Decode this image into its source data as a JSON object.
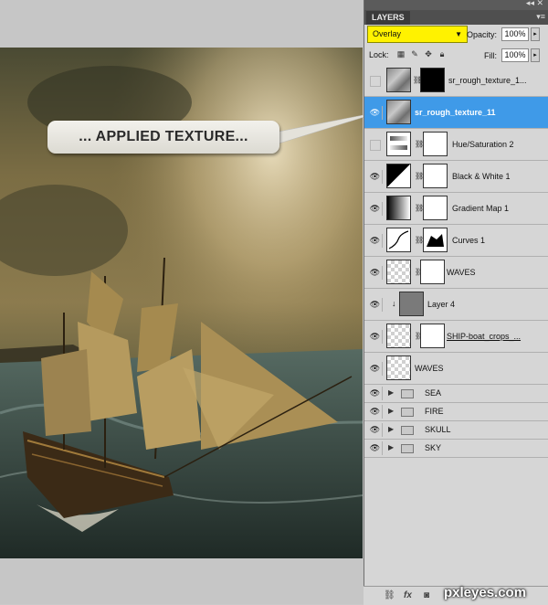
{
  "artwork": {
    "alt": "ship-on-stormy-sea-artwork"
  },
  "callout": {
    "text": "... APPLIED TEXTURE..."
  },
  "panel": {
    "tab": "LAYERS",
    "blend_mode": "Overlay",
    "opacity_label": "Opacity:",
    "opacity_value": "100%",
    "lock_label": "Lock:",
    "fill_label": "Fill:",
    "fill_value": "100%"
  },
  "layers": [
    {
      "name": "sr_rough_texture_1...",
      "visible": false,
      "selected": false
    },
    {
      "name": "sr_rough_texture_11",
      "visible": true,
      "selected": true
    },
    {
      "name": "Hue/Saturation 2",
      "visible": false,
      "selected": false
    },
    {
      "name": "Black & White 1",
      "visible": true,
      "selected": false
    },
    {
      "name": "Gradient Map 1",
      "visible": true,
      "selected": false
    },
    {
      "name": "Curves 1",
      "visible": true,
      "selected": false
    },
    {
      "name": "WAVES",
      "visible": true,
      "selected": false
    },
    {
      "name": "Layer 4",
      "visible": true,
      "selected": false
    },
    {
      "name": "SHIP-boat_crops_...",
      "visible": true,
      "selected": false
    },
    {
      "name": "WAVES",
      "visible": true,
      "selected": false
    }
  ],
  "groups": [
    {
      "name": "SEA"
    },
    {
      "name": "FIRE"
    },
    {
      "name": "SKULL"
    },
    {
      "name": "SKY"
    }
  ],
  "watermark": "pxleyes.com",
  "colors": {
    "selected": "#3f9ae8",
    "blend_highlight": "#fff200"
  }
}
